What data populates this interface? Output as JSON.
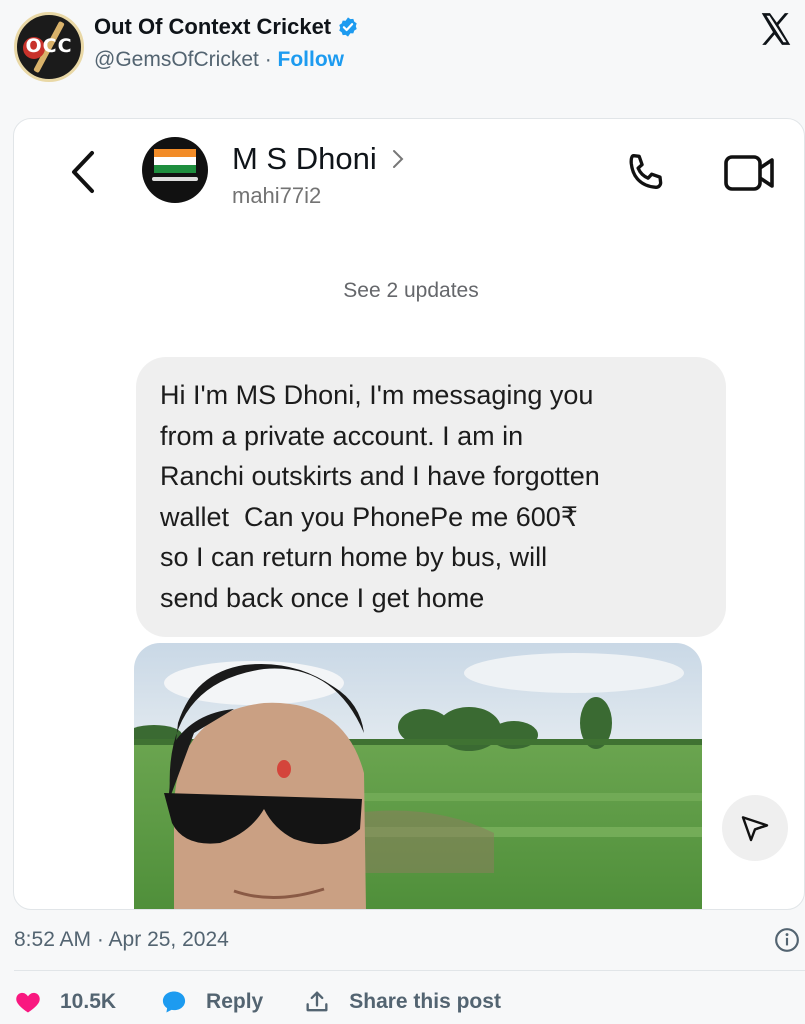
{
  "tweet": {
    "author_name": "Out Of Context Cricket",
    "handle": "@GemsOfCricket",
    "separator": "·",
    "follow_label": "Follow",
    "avatar_text": "OCC",
    "timestamp": "8:52 AM · Apr 25, 2024",
    "likes": "10.5K",
    "reply_label": "Reply",
    "share_label": "Share this post"
  },
  "screenshot": {
    "contact_name": "M S Dhoni",
    "contact_username": "mahi77i2",
    "updates_label": "See 2 updates",
    "message": "Hi I'm MS Dhoni, I'm messaging you\nfrom a private account. I am in\nRanchi outskirts and I have forgotten\nwallet  Can you PhonePe me 600₹\nso I can return home by bus, will\nsend back once I get home"
  },
  "colors": {
    "link_blue": "#1d9bf0",
    "like_pink": "#f91880",
    "verified_blue": "#1d9bf0",
    "bubble_gray": "#efefef"
  },
  "icons": [
    "verified-badge-icon",
    "x-logo-icon",
    "back-chevron-icon",
    "phone-icon",
    "video-camera-icon",
    "send-icon",
    "info-icon",
    "heart-icon",
    "reply-bubble-icon",
    "share-icon"
  ]
}
